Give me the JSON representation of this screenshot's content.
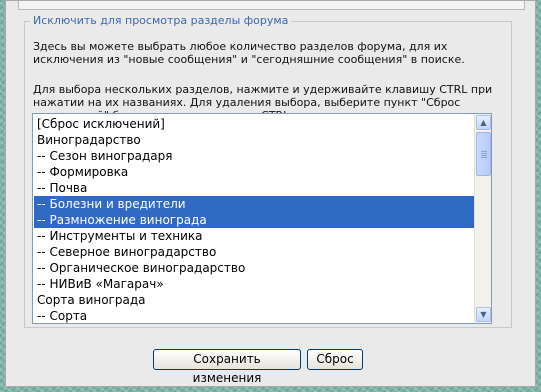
{
  "fieldset": {
    "legend": "Исключить для просмотра разделы форума",
    "description_1": "Здесь вы можете выбрать любое количество разделов форума, для их исключения из \"новые сообщения\" и \"сегодняшние сообщения\" в поиске.",
    "description_2": "Для выбора нескольких разделов, нажмите и удерживайте клавишу CTRL при нажатии на их названиях. Для удаления выбора, выберите пункт \"Сброс исключений\" без нажатия на клавишу CTRL."
  },
  "forum_list": {
    "options": [
      {
        "label": "[Сброс исключений]",
        "selected": false
      },
      {
        "label": "Виноградарство",
        "selected": false
      },
      {
        "label": "-- Сезон виноградаря",
        "selected": false
      },
      {
        "label": "-- Формировка",
        "selected": false
      },
      {
        "label": "-- Почва",
        "selected": false
      },
      {
        "label": "-- Болезни и вредители",
        "selected": true
      },
      {
        "label": "-- Размножение винограда",
        "selected": true
      },
      {
        "label": "-- Инструменты и техника",
        "selected": false
      },
      {
        "label": "-- Северное виноградарство",
        "selected": false
      },
      {
        "label": "-- Органическое виноградарство",
        "selected": false
      },
      {
        "label": "-- НИВиВ «Магарач»",
        "selected": false
      },
      {
        "label": "Сорта винограда",
        "selected": false
      },
      {
        "label": "-- Сорта",
        "selected": false
      }
    ],
    "selected_color": "#316ac5"
  },
  "buttons": {
    "save": "Сохранить изменения",
    "reset": "Сброс"
  },
  "icons": {
    "scroll_up": "chevron-up-icon",
    "scroll_down": "chevron-down-icon"
  }
}
